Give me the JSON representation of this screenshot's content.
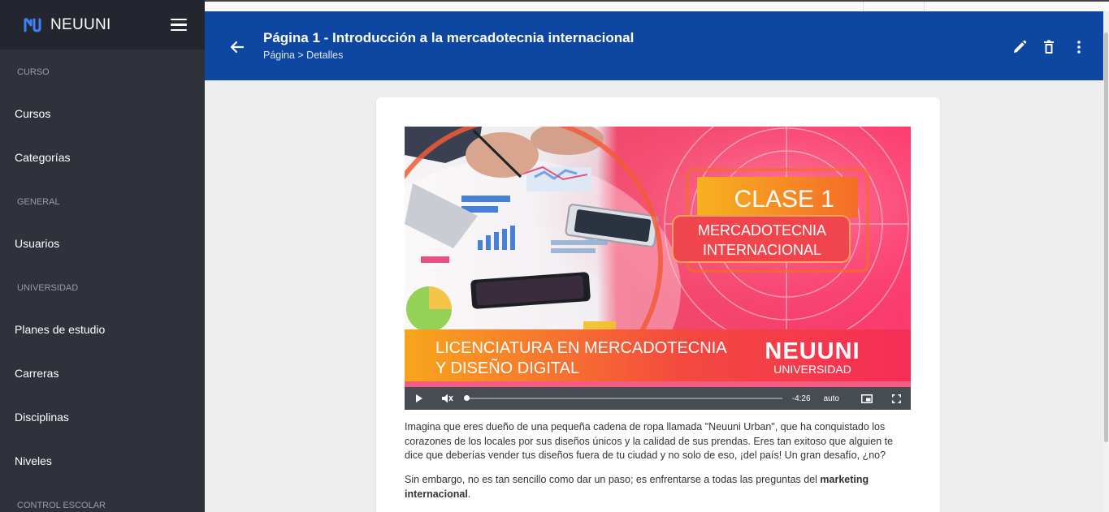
{
  "sidebar": {
    "brand": "NEUUNI",
    "sections": [
      {
        "title": "CURSO",
        "items": [
          "Cursos",
          "Categorías"
        ]
      },
      {
        "title": "GENERAL",
        "items": [
          "Usuarios"
        ]
      },
      {
        "title": "UNIVERSIDAD",
        "items": [
          "Planes de estudio",
          "Carreras",
          "Disciplinas",
          "Niveles"
        ]
      },
      {
        "title": "CONTROL ESCOLAR",
        "items": []
      }
    ]
  },
  "header": {
    "title": "Página 1 - Introducción a la mercadotecnia internacional",
    "breadcrumb": "Página > Detalles"
  },
  "video": {
    "badge_title": "CLASE 1",
    "badge_subtitle_line1": "MERCADOTECNIA",
    "badge_subtitle_line2": "INTERNACIONAL",
    "banner_line1": "LICENCIATURA EN MERCADOTECNIA",
    "banner_line2": "Y DISEÑO DIGITAL",
    "logo_text": "NEUUNI",
    "logo_sub": "UNIVERSIDAD",
    "time": "-4:26",
    "quality": "auto",
    "progress": 0
  },
  "content": {
    "paragraph1": "Imagina que eres dueño de una pequeña cadena de ropa llamada \"Neuuni Urban\", que ha conquistado los corazones de los locales por sus diseños únicos y la calidad de sus prendas. Eres tan exitoso que alguien te dice que deberías vender tus diseños fuera de tu ciudad y no solo de eso, ¡del país! Un gran desafío, ¿no?",
    "paragraph2_start": "Sin embargo, no es tan sencillo como dar un paso; es enfrentarse a todas las preguntas del ",
    "paragraph2_bold": "marketing internacional",
    "paragraph2_end": "."
  },
  "colors": {
    "header": "#0d47a1",
    "sidebar": "#2f323b",
    "brand_bar": "#23262e"
  }
}
